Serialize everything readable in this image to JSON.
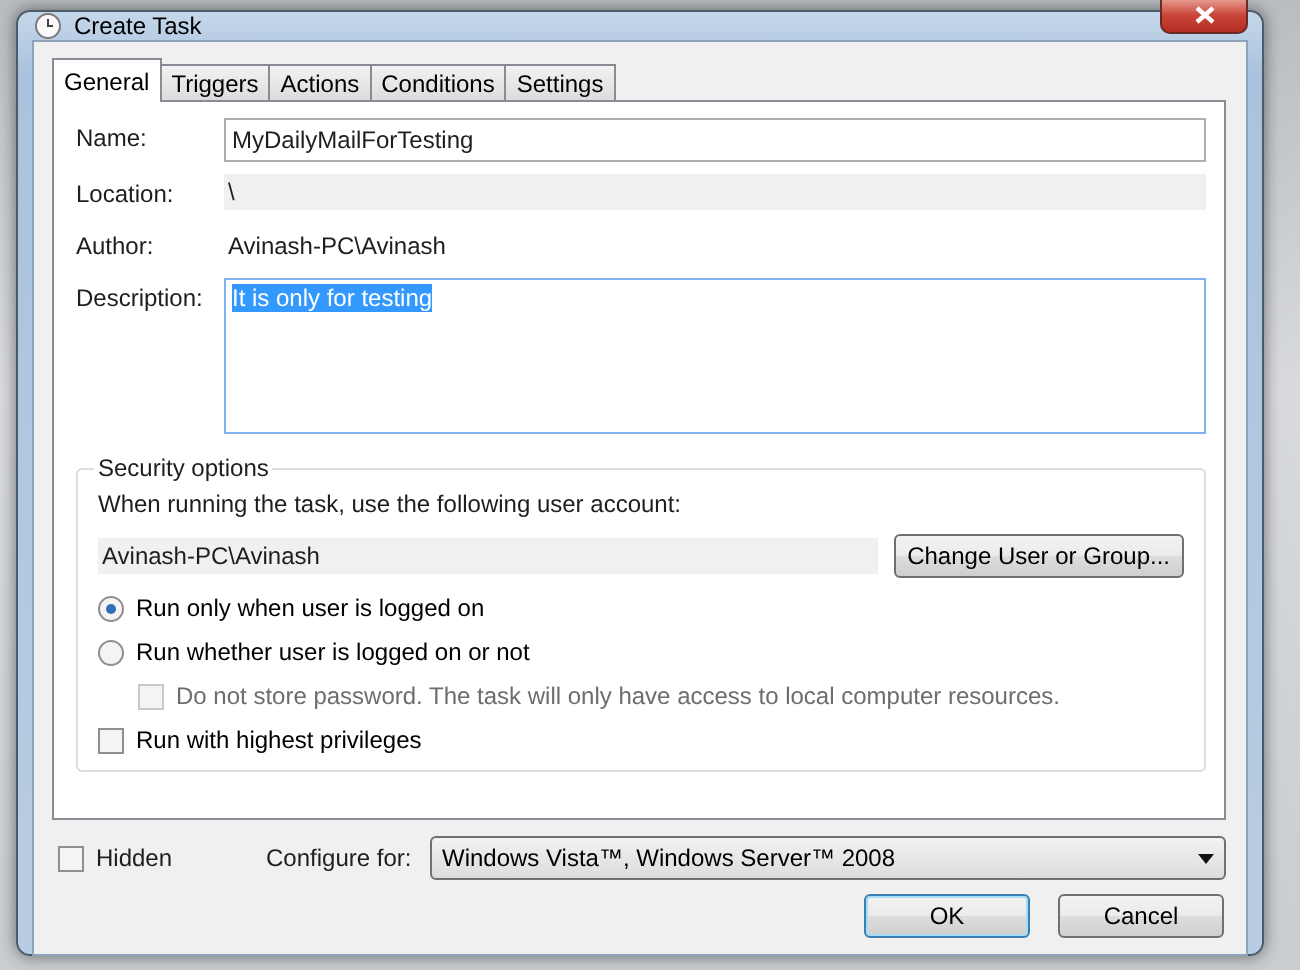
{
  "window": {
    "title": "Create Task"
  },
  "tabs": [
    {
      "label": "General",
      "selected": true
    },
    {
      "label": "Triggers",
      "selected": false
    },
    {
      "label": "Actions",
      "selected": false
    },
    {
      "label": "Conditions",
      "selected": false
    },
    {
      "label": "Settings",
      "selected": false
    }
  ],
  "fields": [
    {
      "label": "Name:",
      "value": "MyDailyMailForTesting",
      "kind": "input"
    },
    {
      "label": "Location:",
      "value": "\\",
      "kind": "readonly"
    },
    {
      "label": "Author:",
      "value": "Avinash-PC\\Avinash",
      "kind": "text"
    },
    {
      "label": "Description:",
      "value": "It is only for testing ",
      "kind": "textarea",
      "text_selected": true
    }
  ],
  "security": {
    "title": "Security options",
    "prompt": "When running the task, use the following user account:",
    "account": "Avinash-PC\\Avinash",
    "change_button": "Change User or Group...",
    "options": [
      {
        "kind": "radio",
        "label": "Run only when user is logged on",
        "selected": true,
        "disabled": false
      },
      {
        "kind": "radio",
        "label": "Run whether user is logged on or not",
        "selected": false,
        "disabled": false
      },
      {
        "kind": "checkbox",
        "label": "Do not store password.  The task will only have access to local computer resources.",
        "checked": false,
        "disabled": true
      },
      {
        "kind": "checkbox",
        "label": "Run with highest privileges",
        "checked": false,
        "disabled": false
      }
    ]
  },
  "hidden": {
    "label": "Hidden",
    "checked": false
  },
  "configure": {
    "label": "Configure for:",
    "value": "Windows Vista™, Windows Server™ 2008"
  },
  "buttons": [
    {
      "label": "OK",
      "default": true
    },
    {
      "label": "Cancel",
      "default": false
    }
  ]
}
